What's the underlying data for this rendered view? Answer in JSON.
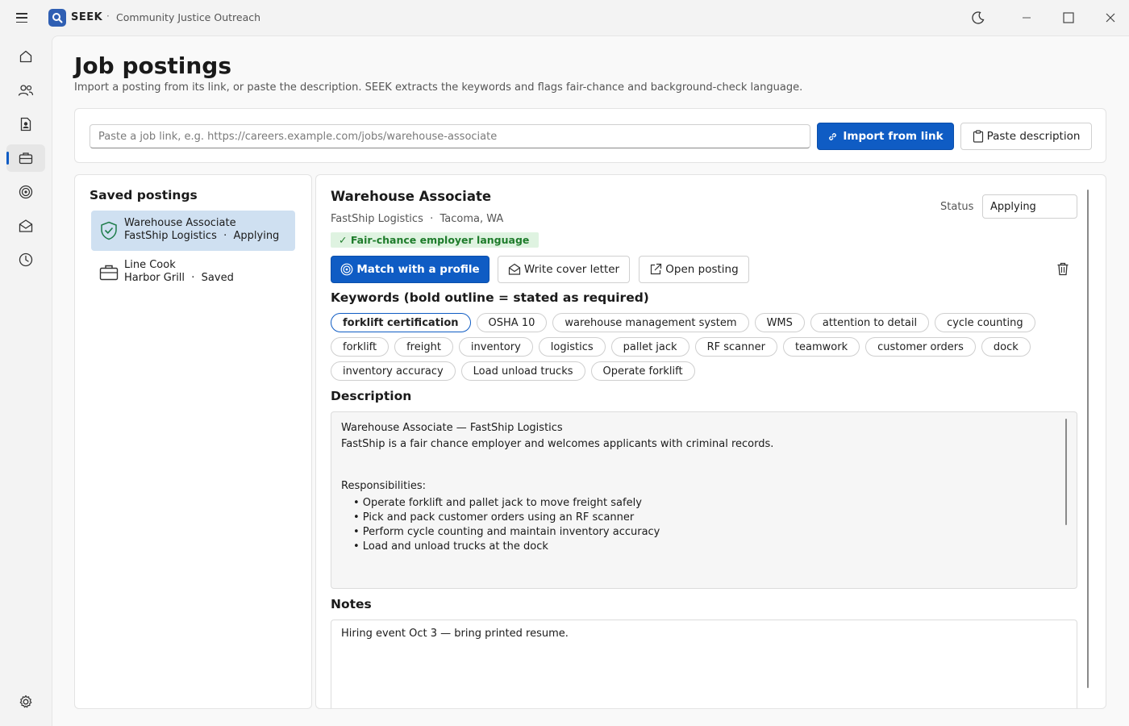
{
  "app": {
    "name": "SEEK",
    "separator": "·",
    "org": "Community Justice Outreach"
  },
  "page": {
    "title": "Job postings",
    "subtitle": "Import a posting from its link, or paste the description. SEEK extracts the keywords and flags fair-chance and background-check language."
  },
  "import": {
    "placeholder": "Paste a job link, e.g. https://careers.example.com/jobs/warehouse-associate",
    "import_label": "Import from link",
    "paste_label": "Paste description"
  },
  "saved": {
    "title": "Saved postings",
    "items": [
      {
        "title": "Warehouse Associate",
        "meta": "FastShip Logistics  ·  Applying",
        "icon": "shield-check-icon"
      },
      {
        "title": "Line Cook",
        "meta": "Harbor Grill  ·  Saved",
        "icon": "briefcase-icon"
      }
    ]
  },
  "detail": {
    "title": "Warehouse Associate",
    "meta": "FastShip Logistics  ·  Tacoma, WA",
    "fair_badge": "✓ Fair-chance employer language",
    "status_label": "Status",
    "status_value": "Applying",
    "actions": {
      "match": "Match with a profile",
      "cover": "Write cover letter",
      "open": "Open posting"
    },
    "keywords_title": "Keywords (bold outline = stated as required)",
    "keywords": [
      [
        "forklift certification",
        "OSHA 10",
        "warehouse management system",
        "WMS",
        "attention to detail",
        "cycle counting"
      ],
      [
        "forklift",
        "freight",
        "inventory",
        "logistics",
        "pallet jack",
        "RF scanner",
        "teamwork",
        "customer orders",
        "dock"
      ],
      [
        "inventory accuracy",
        "Load unload trucks",
        "Operate forklift"
      ]
    ],
    "required_keywords": [
      "forklift certification"
    ],
    "description_title": "Description",
    "description_line1": "Warehouse Associate — FastShip Logistics",
    "description_line2": "FastShip is a fair chance employer and welcomes applicants with criminal records.",
    "responsibilities_label": "Responsibilities:",
    "bullets": [
      "• Operate forklift and pallet jack to move freight safely",
      "• Pick and pack customer orders using an RF scanner",
      "• Perform cycle counting and maintain inventory accuracy",
      "• Load and unload trucks at the dock"
    ],
    "notes_title": "Notes",
    "notes": "Hiring event Oct 3 — bring printed resume."
  },
  "colors": {
    "accent": "#0f5cc4",
    "selected_bg": "#cfe0f1",
    "fair_bg": "#dff3e1",
    "fair_text": "#1e7c2b"
  }
}
